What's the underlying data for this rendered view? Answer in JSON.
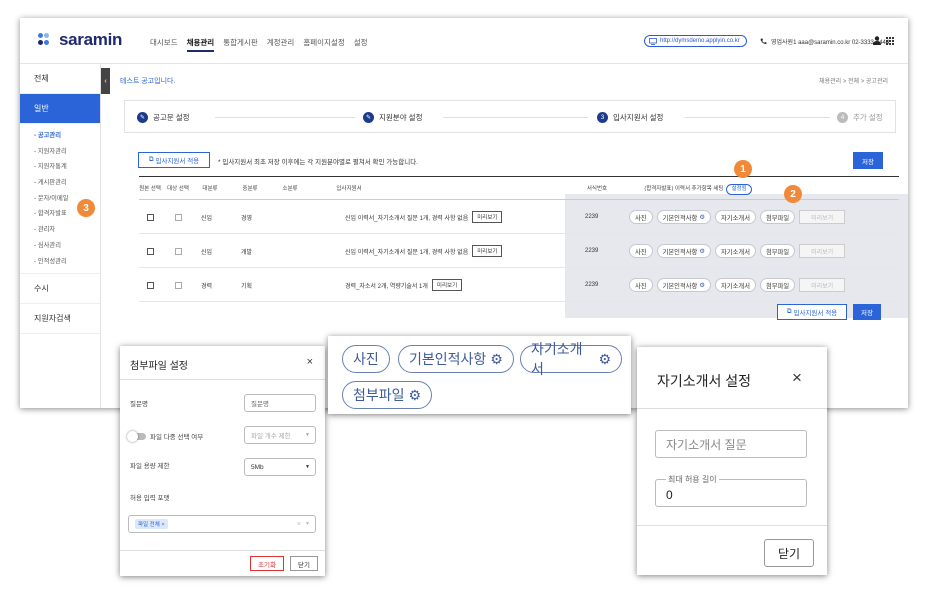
{
  "header": {
    "logo_text": "saramin",
    "nav": [
      "대시보드",
      "채용관리",
      "통합게시판",
      "계정관리",
      "홈페이지설정",
      "설정"
    ],
    "url": "http://dymsdemo.applyin.co.kr",
    "contact": "영업사원1 aaa@saramin.co.kr 02-3333-4444"
  },
  "sidebar": {
    "all": "전체",
    "general": "일반",
    "sub_items": [
      "- 공고관리",
      "- 지원자관리",
      "- 지원자통계",
      "- 게시판관리",
      "- 문자/이메일",
      "- 합격자발표",
      "- 관리자",
      "- 심사관리",
      "- 인적성관리"
    ],
    "occasional": "수시",
    "applicant_search": "지원자검색"
  },
  "page": {
    "title": "테스트 공고입니다.",
    "breadcrumb": "채용관리 > 전체 > 공고관리"
  },
  "steps": [
    {
      "label": "공고문 설정"
    },
    {
      "label": "지원분야 설정"
    },
    {
      "num": "3",
      "label": "입사지원서 설정"
    },
    {
      "num": "4",
      "label": "추가 설정"
    }
  ],
  "toolbar": {
    "apply_label": "입사지원서 적용",
    "notice": "* 입사지원서 최초 저장 이후에는 각 지원분야별로 펼쳐서 확인 가능합니다.",
    "save_label": "저장"
  },
  "table": {
    "headers": {
      "origin": "원본 선택",
      "target": "대상 선택",
      "major": "대분류",
      "middle": "중분류",
      "minor": "소분류",
      "form": "입사지원서",
      "form_no": "서식번호",
      "extra_prefix": "(합격자발표) 이력서 추가항목 세팅",
      "setting": "설정됨"
    },
    "rows": [
      {
        "major": "신입",
        "middle": "경영",
        "form": "신입 이력서_자기소개서 질문 1개, 경력 사항 없음",
        "preview": "미리보기",
        "form_no": "2239"
      },
      {
        "major": "신입",
        "middle": "개발",
        "form": "신입 이력서_자기소개서 질문 1개, 경력 사항 없음",
        "preview": "미리보기",
        "form_no": "2239"
      },
      {
        "major": "경력",
        "middle": "기획",
        "form": "경력_자소서 2개, 역량기술서 1개",
        "preview": "미리보기",
        "form_no": "2239"
      }
    ],
    "chips": {
      "photo": "사진",
      "basic": "기본인적사항",
      "intro": "자기소개서",
      "attach": "첨부파일",
      "preview": "미리보기"
    }
  },
  "badges": [
    "1",
    "2",
    "3"
  ],
  "attach_popup": {
    "title": "첨부파일 설정",
    "label_name": "질문명",
    "name_placeholder": "질문명",
    "label_multi": "파일 다중 선택 여부",
    "count_placeholder": "파일 개수 제한",
    "label_size": "파일 용량 제한",
    "size_value": "5Mb",
    "label_format": "허용 입력 포맷",
    "format_tag": "파일 전체",
    "reset": "초기화",
    "close": "닫기"
  },
  "chip_zoom": [
    "사진",
    "기본인적사항",
    "자기소개서",
    "첨부파일"
  ],
  "intro_popup": {
    "title": "자기소개서 설정",
    "question_placeholder": "자기소개서 질문",
    "max_label": "최대 허용 길이",
    "max_value": "0",
    "close": "닫기"
  },
  "colors": {
    "brand": "#1e2a6e",
    "accent": "#2a64d8",
    "badge": "#f08a3a",
    "panel": "#e6e8ed"
  }
}
